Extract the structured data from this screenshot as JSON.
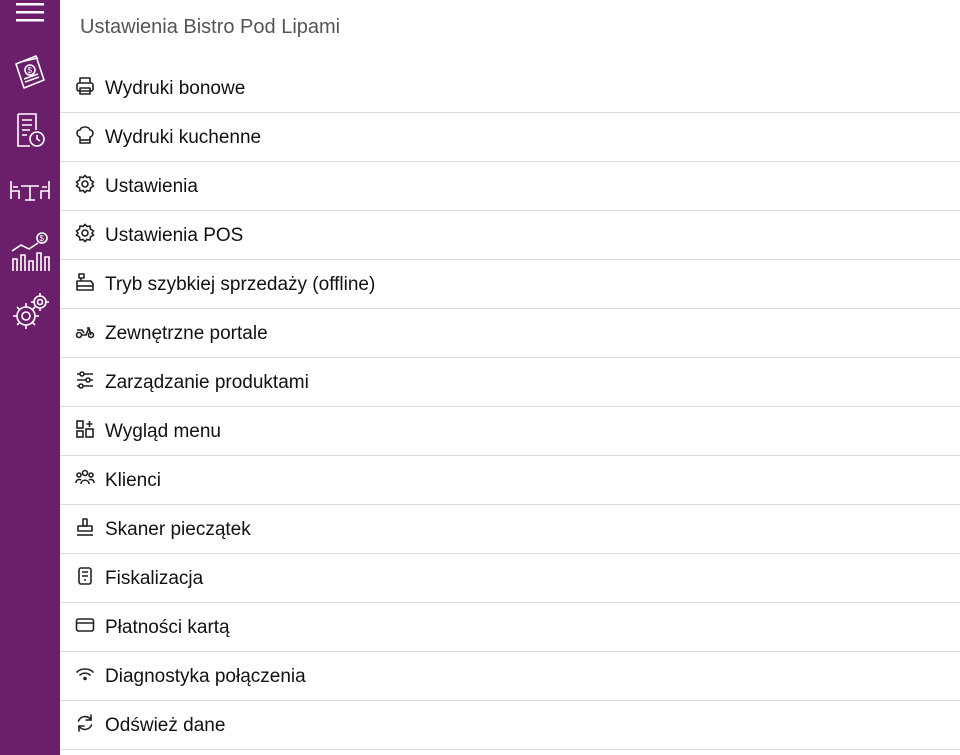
{
  "app": {
    "title": "Ustawienia Bistro Pod Lipami",
    "accent_color": "#6b1f6b"
  },
  "sidebar": {
    "items": [
      {
        "icon": "menu-icon"
      },
      {
        "icon": "receipt-money-icon"
      },
      {
        "icon": "order-history-icon"
      },
      {
        "icon": "tables-icon"
      },
      {
        "icon": "sales-chart-icon"
      },
      {
        "icon": "settings-gears-icon"
      }
    ]
  },
  "menu": {
    "items": [
      {
        "label": "Wydruki bonowe",
        "icon": "printer-icon"
      },
      {
        "label": "Wydruki kuchenne",
        "icon": "chef-hat-icon"
      },
      {
        "label": "Ustawienia",
        "icon": "gear-icon"
      },
      {
        "label": "Ustawienia POS",
        "icon": "gear-icon"
      },
      {
        "label": "Tryb szybkiej sprzedaży (offline)",
        "icon": "cash-register-icon"
      },
      {
        "label": "Zewnętrzne portale",
        "icon": "scooter-icon"
      },
      {
        "label": "Zarządzanie produktami",
        "icon": "sliders-icon"
      },
      {
        "label": "Wygląd menu",
        "icon": "layout-grid-add-icon"
      },
      {
        "label": "Klienci",
        "icon": "users-icon"
      },
      {
        "label": "Skaner pieczątek",
        "icon": "stamp-icon"
      },
      {
        "label": "Fiskalizacja",
        "icon": "receipt-icon"
      },
      {
        "label": "Płatności kartą",
        "icon": "credit-card-icon"
      },
      {
        "label": "Diagnostyka połączenia",
        "icon": "wifi-icon"
      },
      {
        "label": "Odśwież dane",
        "icon": "refresh-icon"
      }
    ]
  }
}
